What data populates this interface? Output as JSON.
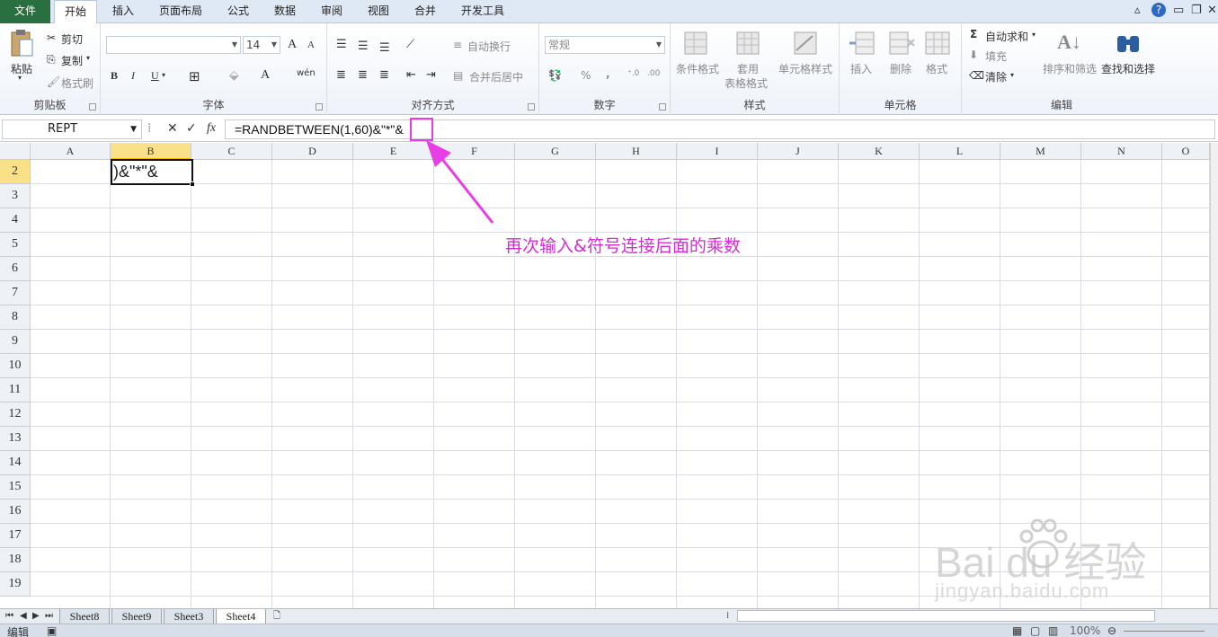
{
  "ribbon_tabs": [
    "文件",
    "开始",
    "插入",
    "页面布局",
    "公式",
    "数据",
    "审阅",
    "视图",
    "合并",
    "开发工具"
  ],
  "clipboard": {
    "paste": "粘贴",
    "cut": "剪切",
    "copy": "复制",
    "format_painter": "格式刷",
    "group": "剪贴板"
  },
  "font": {
    "size": "14",
    "group": "字体",
    "bold": "B",
    "italic": "I",
    "underline": "U",
    "grow": "A",
    "shrink": "A",
    "color_a": "A",
    "phonetic": "wén"
  },
  "alignment": {
    "wrap": "自动换行",
    "merge": "合并后居中",
    "group": "对齐方式"
  },
  "number": {
    "format": "常规",
    "percent": "%",
    "comma": ",",
    "group": "数字"
  },
  "styles": {
    "conditional": "条件格式",
    "table_line1": "套用",
    "table_line2": "表格格式",
    "cell_styles": "单元格样式",
    "group": "样式"
  },
  "cells": {
    "insert": "插入",
    "delete": "删除",
    "format": "格式",
    "group": "单元格"
  },
  "editing": {
    "autosum": "自动求和",
    "fill": "填充",
    "clear": "清除",
    "sort": "排序和筛选",
    "find": "查找和选择",
    "group": "编辑",
    "sigma": "Σ"
  },
  "formula_bar": {
    "name_box": "REPT",
    "fx": "fx",
    "formula": "=RANDBETWEEN(1,60)&\"*\"&"
  },
  "columns": [
    "A",
    "B",
    "C",
    "D",
    "E",
    "F",
    "G",
    "H",
    "I",
    "J",
    "K",
    "L",
    "M",
    "N",
    "O"
  ],
  "rows": [
    "2",
    "3",
    "4",
    "5",
    "6",
    "7",
    "8",
    "9",
    "10",
    "11",
    "12",
    "13",
    "14",
    "15",
    "16",
    "17",
    "18",
    "19"
  ],
  "active_cell_text": ")&\"*\"&",
  "sheets": [
    "Sheet8",
    "Sheet9",
    "Sheet3",
    "Sheet4"
  ],
  "active_sheet": "Sheet4",
  "status": {
    "mode": "编辑",
    "zoom": "100%"
  },
  "annotation": "再次输入&符号连接后面的乘数",
  "watermark": {
    "logo": "Bai du 经验",
    "url": "jingyan.baidu.com"
  },
  "colors": {
    "annotation": "#d42cd4",
    "file_tab": "#2a6f3f",
    "selected_header": "#fbe08a"
  }
}
